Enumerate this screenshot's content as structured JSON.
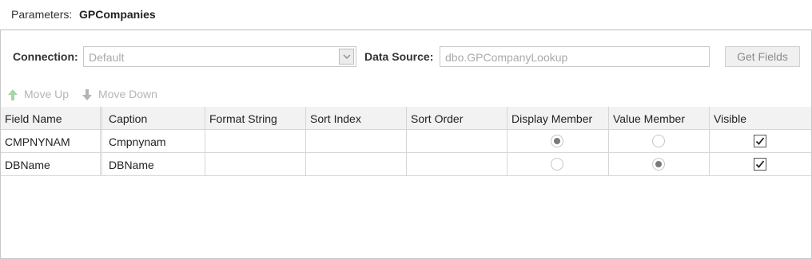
{
  "header": {
    "label": "Parameters:",
    "name": "GPCompanies"
  },
  "connection": {
    "label": "Connection:",
    "value": "Default"
  },
  "data_source": {
    "label": "Data Source:",
    "value": "dbo.GPCompanyLookup"
  },
  "get_fields_label": "Get Fields",
  "toolbar": {
    "move_up": "Move Up",
    "move_down": "Move Down"
  },
  "grid": {
    "columns": [
      "Field Name",
      "Caption",
      "Format String",
      "Sort Index",
      "Sort Order",
      "Display Member",
      "Value Member",
      "Visible"
    ],
    "rows": [
      {
        "field_name": "CMPNYNAM",
        "caption": "Cmpnynam",
        "format_string": "",
        "sort_index": "",
        "sort_order": "",
        "display_member": true,
        "value_member": false,
        "visible": true
      },
      {
        "field_name": "DBName",
        "caption": "DBName",
        "format_string": "",
        "sort_index": "",
        "sort_order": "",
        "display_member": false,
        "value_member": true,
        "visible": true
      }
    ]
  },
  "colors": {
    "disabled_text": "#a9a9a9",
    "move_up_arrow": "#a6d6a6",
    "move_down_arrow": "#b5b5b5"
  }
}
